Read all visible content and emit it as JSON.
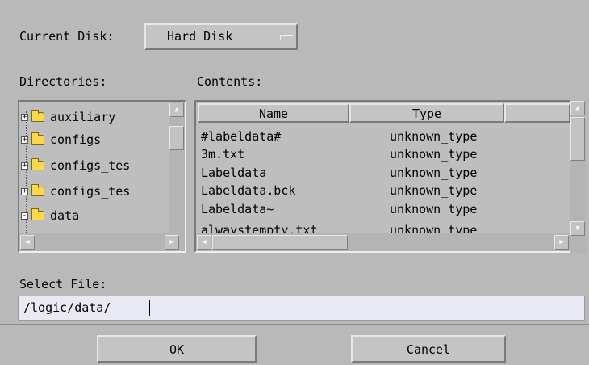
{
  "current_disk": {
    "label": "Current Disk:",
    "value": "Hard Disk"
  },
  "directories": {
    "label": "Directories:",
    "items": [
      {
        "name": "auxiliary",
        "expander": "+"
      },
      {
        "name": "configs",
        "expander": "+"
      },
      {
        "name": "configs_tes",
        "expander": "+"
      },
      {
        "name": "configs_tes",
        "expander": "+"
      },
      {
        "name": "data",
        "expander": "-"
      }
    ]
  },
  "contents": {
    "label": "Contents:",
    "columns": [
      "Name",
      "Type"
    ],
    "rows": [
      {
        "name": "#labeldata#",
        "type": "unknown_type"
      },
      {
        "name": "3m.txt",
        "type": "unknown_type"
      },
      {
        "name": "Labeldata",
        "type": "unknown_type"
      },
      {
        "name": "Labeldata.bck",
        "type": "unknown_type"
      },
      {
        "name": "Labeldata~",
        "type": "unknown_type"
      },
      {
        "name": "alwaystempty.txt",
        "type": "unknown_type"
      }
    ]
  },
  "select_file": {
    "label": "Select File:",
    "value": "/logic/data/"
  },
  "buttons": {
    "ok": "OK",
    "cancel": "Cancel"
  }
}
